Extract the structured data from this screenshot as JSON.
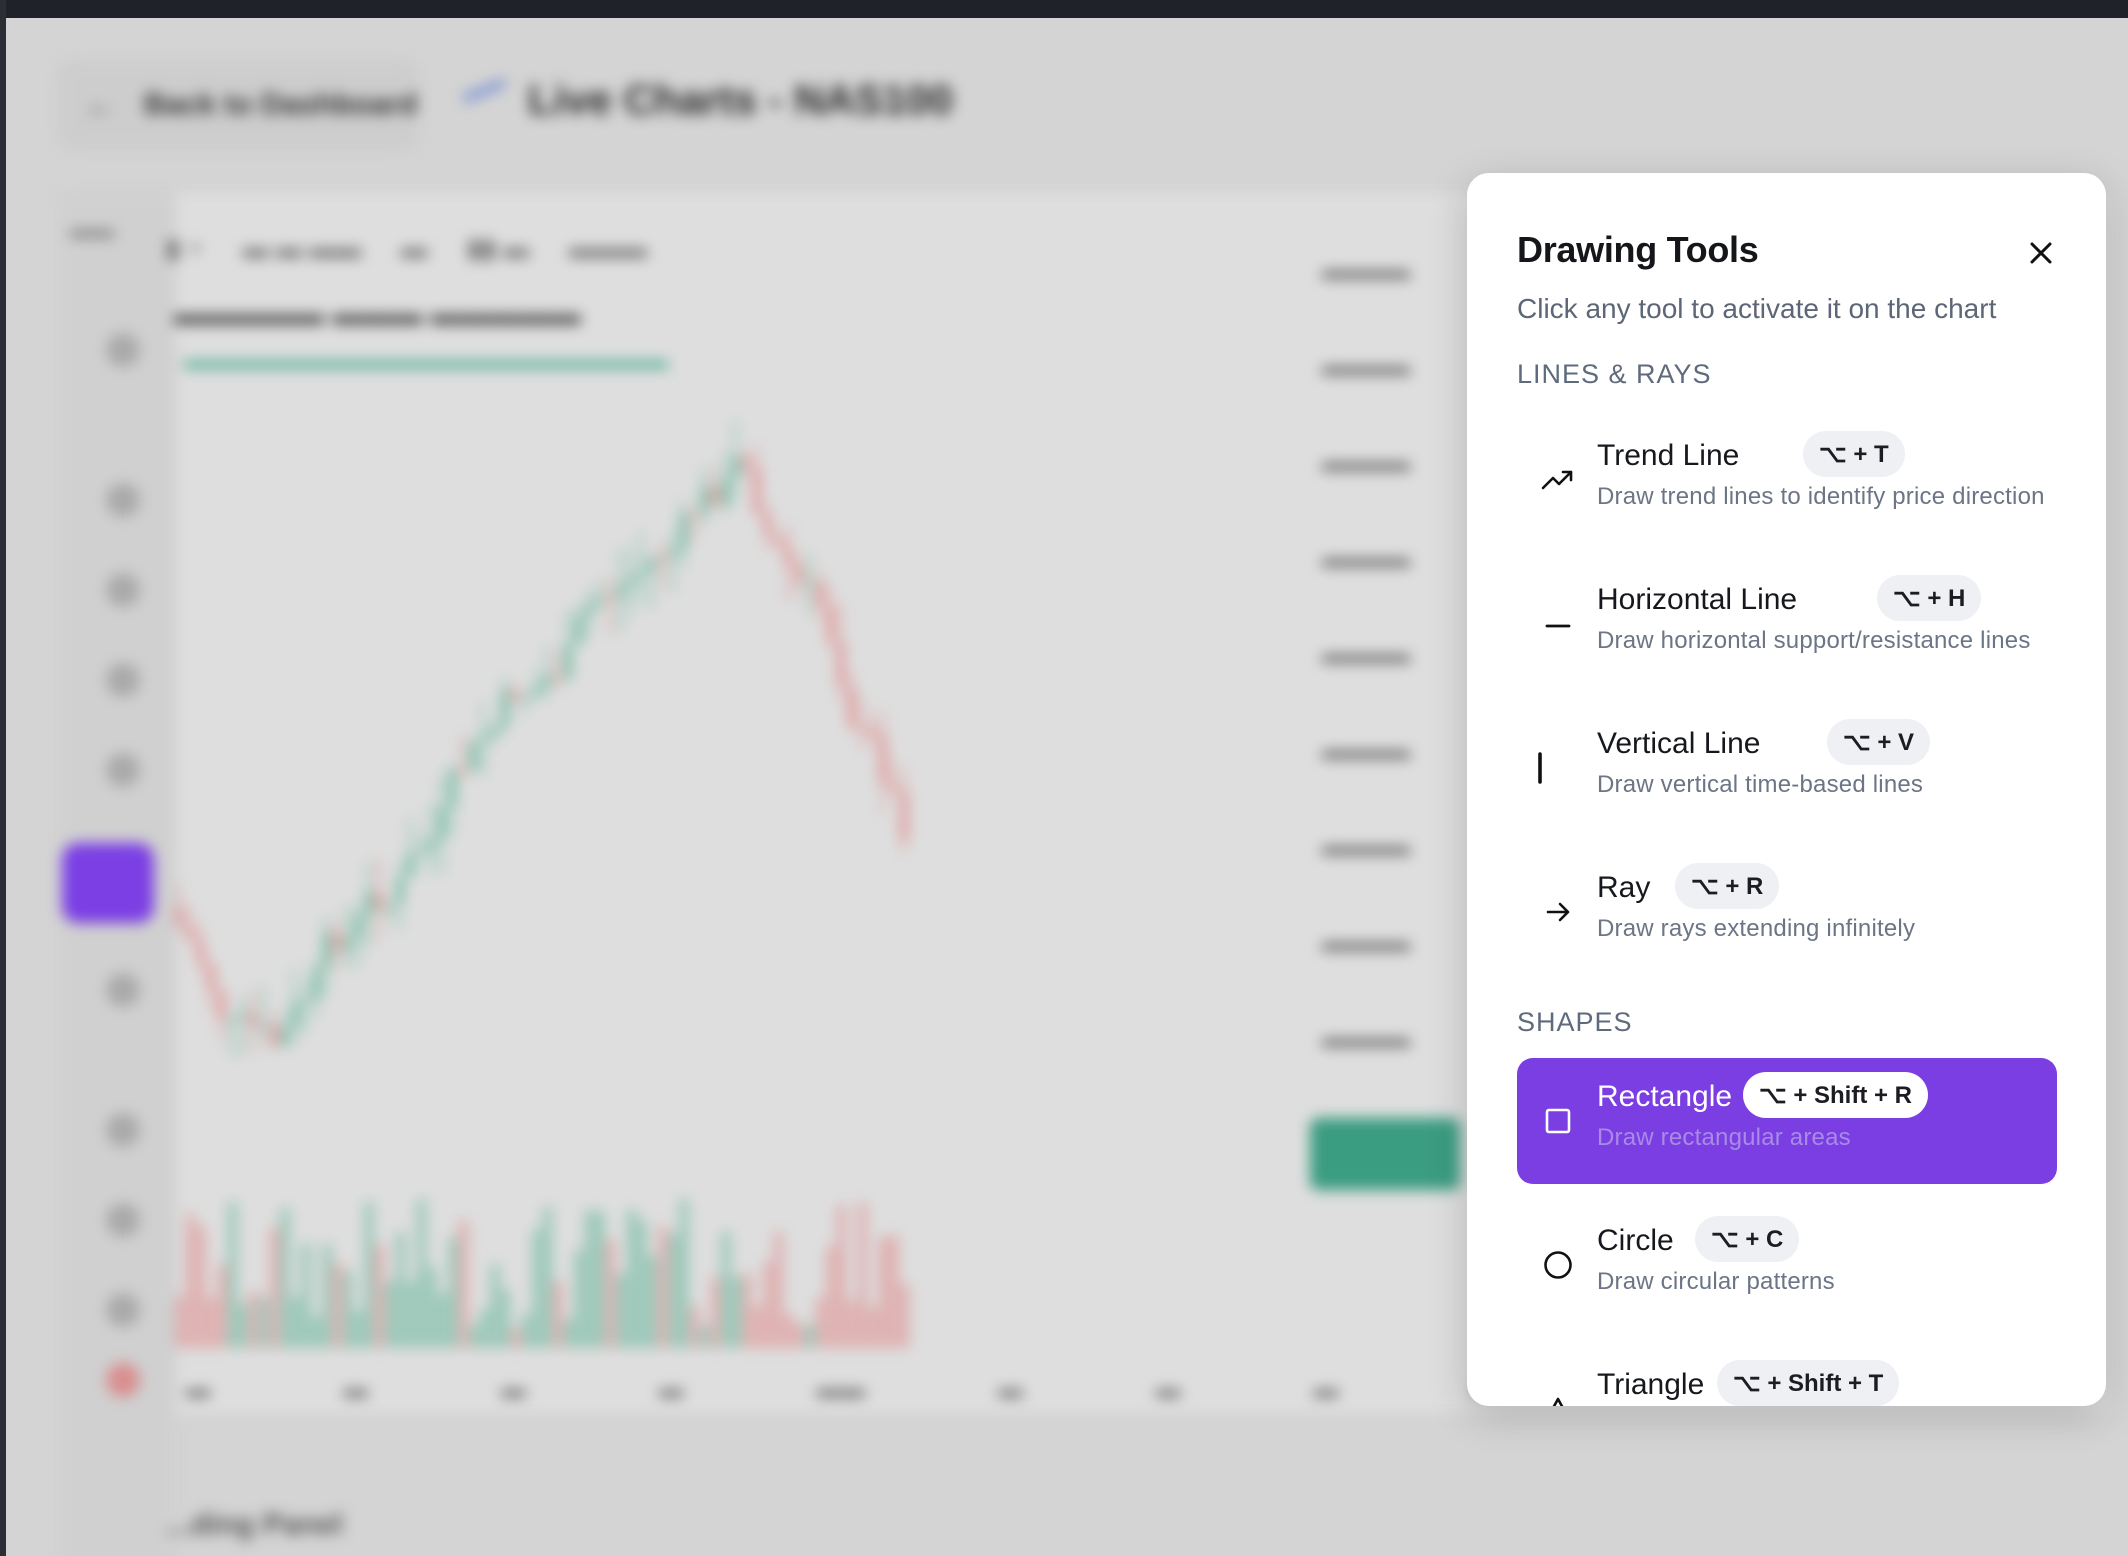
{
  "background": {
    "back_button_label": "Back to Dashboard",
    "page_title": "Live Charts - NAS100",
    "bottom_panel_label": "...ding Panel"
  },
  "drawing_tools": {
    "title": "Drawing Tools",
    "subtitle": "Click any tool to activate it on the chart",
    "sections": {
      "lines": "LINES & RAYS",
      "shapes": "SHAPES"
    },
    "tools": [
      {
        "name": "Trend Line",
        "shortcut": "⌥ + T",
        "desc": "Draw trend lines to identify price direction",
        "icon": "trend-line-icon",
        "active": false
      },
      {
        "name": "Horizontal Line",
        "shortcut": "⌥ + H",
        "desc": "Draw horizontal support/resistance lines",
        "icon": "horizontal-line-icon",
        "active": false
      },
      {
        "name": "Vertical Line",
        "shortcut": "⌥ + V",
        "desc": "Draw vertical time-based lines",
        "icon": "vertical-line-icon",
        "active": false
      },
      {
        "name": "Ray",
        "shortcut": "⌥ + R",
        "desc": "Draw rays extending infinitely",
        "icon": "ray-arrow-icon",
        "active": false
      },
      {
        "name": "Rectangle",
        "shortcut": "⌥ + Shift + R",
        "desc": "Draw rectangular areas",
        "icon": "rectangle-icon",
        "active": true
      },
      {
        "name": "Circle",
        "shortcut": "⌥ + C",
        "desc": "Draw circular patterns",
        "icon": "circle-icon",
        "active": false
      },
      {
        "name": "Triangle",
        "shortcut": "⌥ + Shift + T",
        "desc": "",
        "icon": "triangle-icon",
        "active": false
      }
    ],
    "colors": {
      "active_bg": "#7a3ee3",
      "badge_bg": "#eef0f3"
    }
  }
}
